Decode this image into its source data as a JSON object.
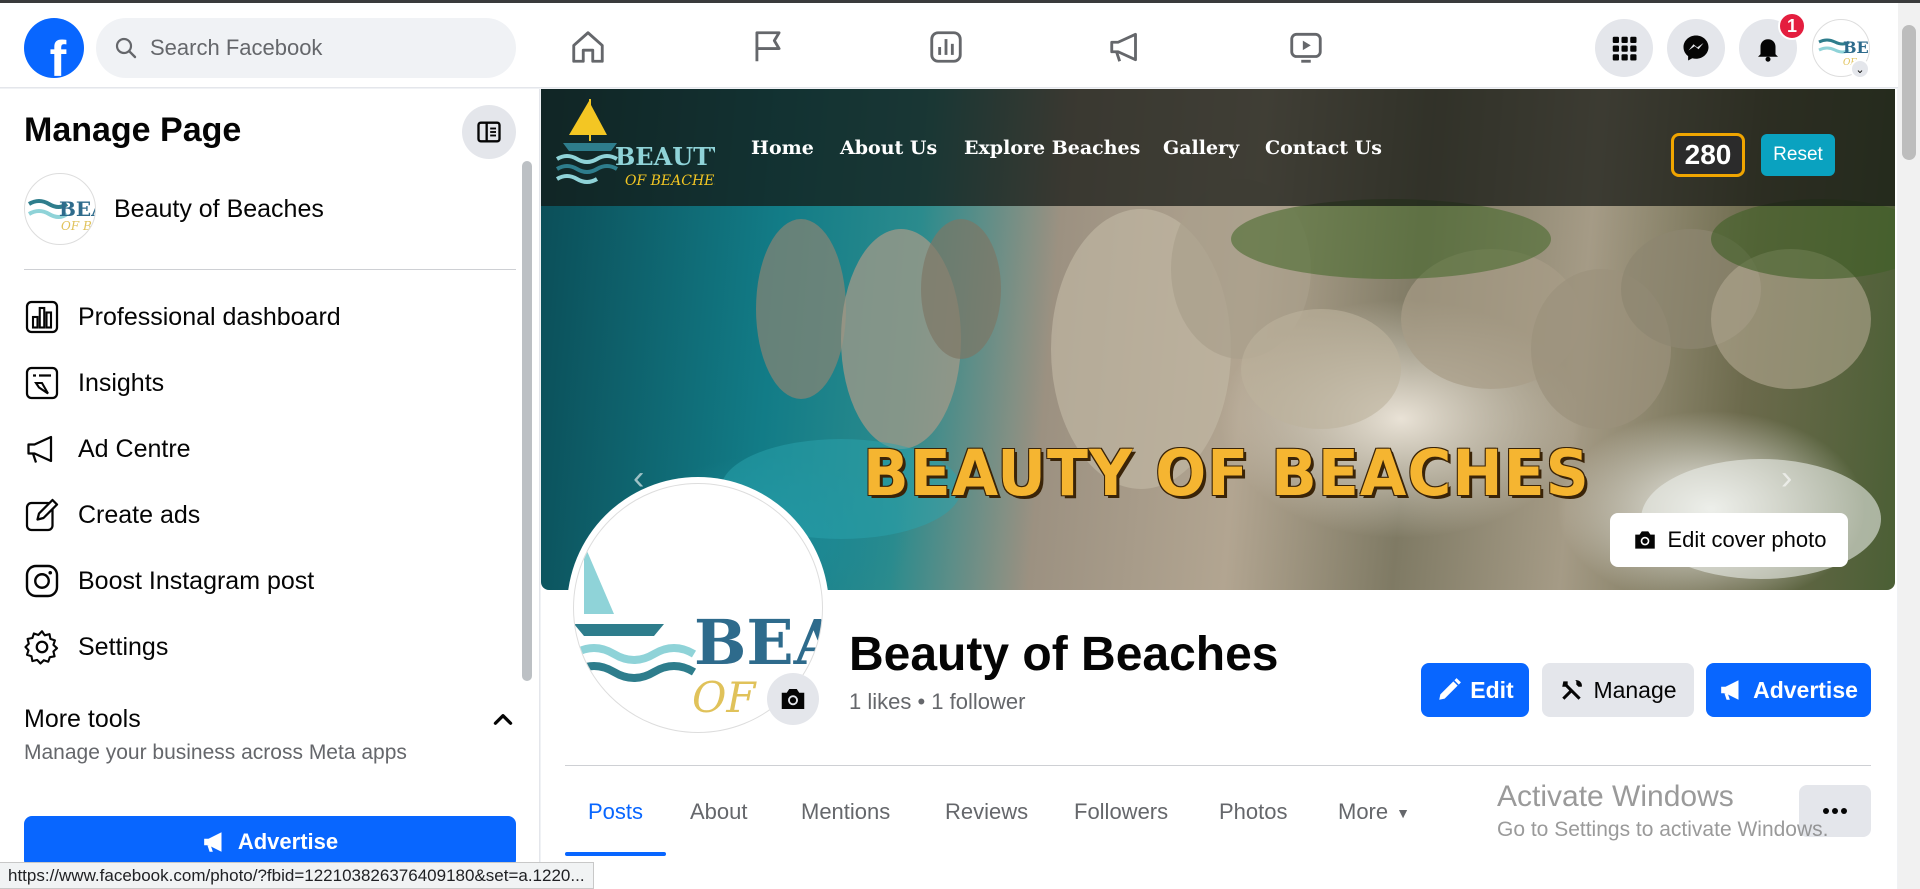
{
  "header": {
    "logo_letter": "f",
    "search_placeholder": "Search Facebook",
    "notification_count": "1"
  },
  "sidebar": {
    "title": "Manage Page",
    "page_name": "Beauty of Beaches",
    "items": [
      {
        "label": "Professional dashboard",
        "icon": "dashboard-icon"
      },
      {
        "label": "Insights",
        "icon": "insights-icon"
      },
      {
        "label": "Ad Centre",
        "icon": "megaphone-icon"
      },
      {
        "label": "Create ads",
        "icon": "edit-icon"
      },
      {
        "label": "Boost Instagram post",
        "icon": "instagram-icon"
      },
      {
        "label": "Settings",
        "icon": "gear-icon"
      }
    ],
    "more_tools_title": "More tools",
    "more_tools_subtitle": "Manage your business across Meta apps",
    "advertise_label": "Advertise"
  },
  "cover": {
    "logo_text_1": "BEAUTY",
    "logo_text_2": "OF BEACHES",
    "nav_links": [
      "Home",
      "About Us",
      "Explore Beaches",
      "Gallery",
      "Contact Us"
    ],
    "counter": "280",
    "reset_label": "Reset",
    "banner_title": "BEAUTY OF BEACHES",
    "edit_cover_label": "Edit cover photo"
  },
  "profile": {
    "name": "Beauty of Beaches",
    "stats": "1 likes • 1 follower",
    "logo_text_1": "BEA",
    "logo_text_2": "OF B"
  },
  "actions": {
    "edit": "Edit",
    "manage": "Manage",
    "advertise": "Advertise"
  },
  "tabs": [
    "Posts",
    "About",
    "Mentions",
    "Reviews",
    "Followers",
    "Photos",
    "More"
  ],
  "overlay": {
    "activate_title": "Activate Windows",
    "activate_sub": "Go to Settings to activate Windows."
  },
  "status_bar_url": "https://www.facebook.com/photo/?fbid=122103826376409180&set=a.1220...",
  "colors": {
    "facebook_blue": "#0866ff",
    "badge_red": "#e41e3f",
    "banner_gold": "#f5b531"
  }
}
